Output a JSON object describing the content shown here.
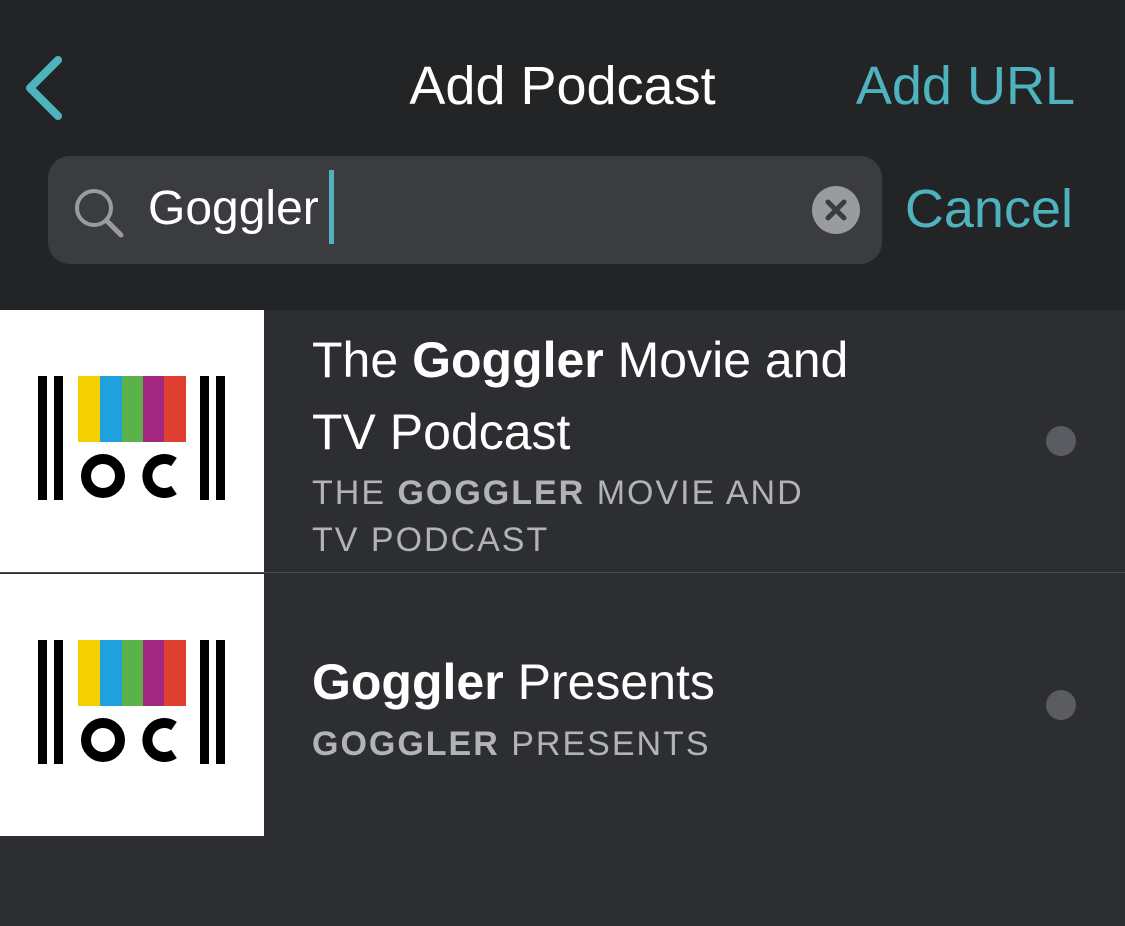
{
  "header": {
    "title": "Add Podcast",
    "add_url_label": "Add URL",
    "back_icon": "chevron-left-icon",
    "accent_color": "#4fb3bf"
  },
  "search": {
    "value": "Goggler",
    "cancel_label": "Cancel",
    "search_icon": "search-icon",
    "clear_icon": "clear-icon"
  },
  "results": [
    {
      "title_before": "The ",
      "title_match": "Goggler",
      "title_after_line1": " Movie and",
      "title_line2": "TV Podcast",
      "sub_before": "THE ",
      "sub_match": "GOGGLER",
      "sub_after_line1": " MOVIE AND",
      "sub_line2": "TV PODCAST",
      "artwork": "goggler-logo"
    },
    {
      "title_match": "Goggler",
      "title_after": " Presents",
      "sub_match": "GOGGLER",
      "sub_after": " PRESENTS",
      "artwork": "goggler-logo"
    }
  ]
}
